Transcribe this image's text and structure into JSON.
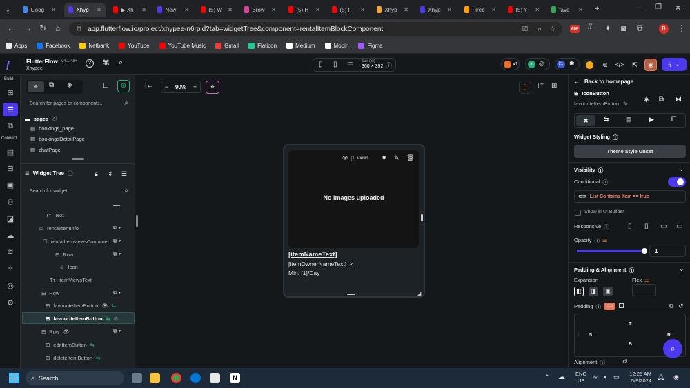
{
  "browser": {
    "tabs": [
      {
        "label": "Goog",
        "color": "#4285f4"
      },
      {
        "label": "Xhyp",
        "color": "#4b39ef",
        "active": true
      },
      {
        "label": "▶ Xh",
        "color": "#ff0000"
      },
      {
        "label": "New",
        "color": "#4b39ef"
      },
      {
        "label": "(5) W",
        "color": "#ff0000"
      },
      {
        "label": "Brow",
        "color": "#e040a0"
      },
      {
        "label": "(5) H",
        "color": "#ff0000"
      },
      {
        "label": "(5) F",
        "color": "#ff0000"
      },
      {
        "label": "Xhyp",
        "color": "#f5a623"
      },
      {
        "label": "Xhyp",
        "color": "#4b39ef"
      },
      {
        "label": "Fireb",
        "color": "#ffa000"
      },
      {
        "label": "(5) Y",
        "color": "#ff0000"
      },
      {
        "label": "favo",
        "color": "#34a853"
      }
    ],
    "url": "app.flutterflow.io/project/xhypee-n6rpjd?tab=widgetTree&component=rentalItemBlockComponent",
    "bookmarks": [
      {
        "label": "Apps",
        "color": "#e8eaed"
      },
      {
        "label": "Facebook",
        "color": "#1877f2"
      },
      {
        "label": "Netbank",
        "color": "#ffcc00"
      },
      {
        "label": "YouTube",
        "color": "#ff0000"
      },
      {
        "label": "YouTube Music",
        "color": "#ff0000"
      },
      {
        "label": "Gmail",
        "color": "#ea4335"
      },
      {
        "label": "Flaticon",
        "color": "#20c997"
      },
      {
        "label": "Medium",
        "color": "#ffffff"
      },
      {
        "label": "Mobin",
        "color": "#ffffff"
      },
      {
        "label": "Figma",
        "color": "#a259ff"
      }
    ],
    "profile": "B",
    "abp": "ABP"
  },
  "app": {
    "brand": "FlutterFlow",
    "version": "v4.1.48+",
    "project": "Xhypee",
    "rail": {
      "build": "Build",
      "connect": "Connect"
    },
    "size_label": "Size (px)",
    "size_value": "360 × 392",
    "badge_v1": "v1",
    "badge_21": "21"
  },
  "left_panel": {
    "search_pages_placeholder": "Search for pages or components...",
    "pages_header": "pages",
    "pages": [
      "bookings_page",
      "bookingsDetailPage",
      "chatPage"
    ],
    "widget_tree_title": "Widget Tree",
    "search_widget_placeholder": "Search for widget...",
    "tree": [
      {
        "label": "Text",
        "icon": "Tт"
      },
      {
        "label": "rentalItemInfo",
        "icon": "▭"
      },
      {
        "label": "rentalItemviewsContainer",
        "icon": "☐"
      },
      {
        "label": "Row",
        "icon": "⊟"
      },
      {
        "label": "Icon",
        "icon": "☺"
      },
      {
        "label": "itemViewsText",
        "icon": "Tт"
      },
      {
        "label": "Row",
        "icon": "⊟"
      },
      {
        "label": "favouriteItemButton",
        "icon": "⊞"
      },
      {
        "label": "favouriteItemButton",
        "icon": "⊞",
        "selected": true
      },
      {
        "label": "Row",
        "icon": "⊟"
      },
      {
        "label": "editItemButton",
        "icon": "⊞"
      },
      {
        "label": "deleteItemButton",
        "icon": "⊞"
      }
    ]
  },
  "canvas": {
    "zoom": "90%",
    "views": "[1] Views",
    "no_images": "No images uploaded",
    "item_name": "[itemNameText]",
    "item_owner": "[itemOwnerNameText]",
    "min_day": "Min. [1]/Day"
  },
  "right_panel": {
    "back": "Back to homepage",
    "widget_type": "IconButton",
    "widget_name": "favouriteItemButton",
    "widget_styling": "Widget Styling",
    "theme_style": "Theme Style Unset",
    "visibility": "Visibility",
    "conditional": "Conditional",
    "condition_text": "List Contains Item  ==  true",
    "show_ui": "Show in UI Builder",
    "responsive": "Responsive",
    "opacity": "Opacity",
    "opacity_value": "1",
    "opacity_level": 1,
    "padding_alignment": "Padding & Alignment",
    "expansion": "Expansion",
    "flex": "Flex",
    "padding": "Padding",
    "pad_t": "T",
    "pad_l": "5",
    "pad_r": "R",
    "pad_b": "B",
    "alignment": "Alignment"
  },
  "taskbar": {
    "search": "Search",
    "lang1": "ENG",
    "lang2": "US",
    "time": "12:25 AM",
    "date": "5/9/2024"
  }
}
